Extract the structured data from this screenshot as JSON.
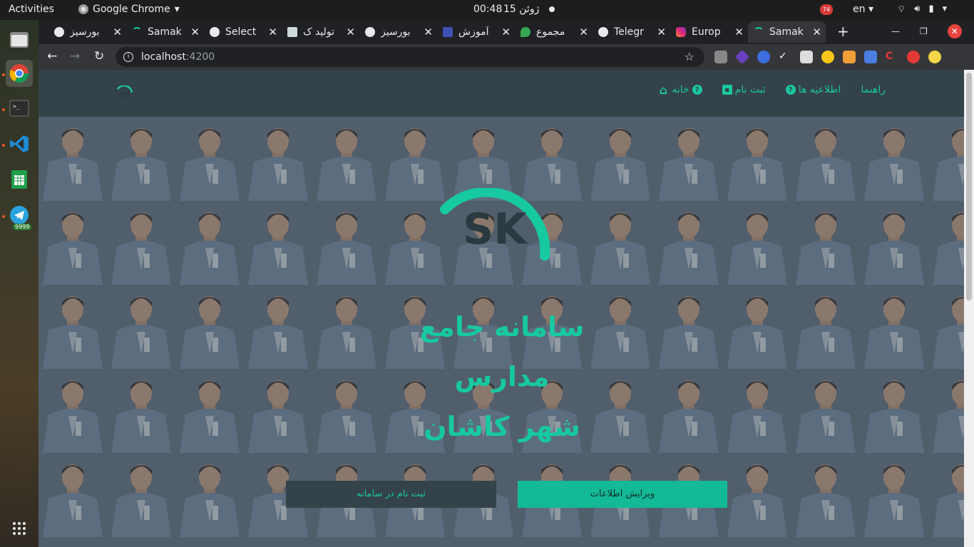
{
  "system": {
    "activities": "Activities",
    "app_name": "Google Chrome",
    "clock_time": "00:48",
    "clock_date": "ژوئن 15",
    "notification_count": "74",
    "lang": "en"
  },
  "dock": {
    "telegram_badge": "9999"
  },
  "browser": {
    "tabs": [
      {
        "title": "بورسیز"
      },
      {
        "title": "Samak"
      },
      {
        "title": "Select"
      },
      {
        "title": "تولید ک"
      },
      {
        "title": "بورسیز"
      },
      {
        "title": "آموزش"
      },
      {
        "title": "مجموع"
      },
      {
        "title": "Telegr"
      },
      {
        "title": "Europ"
      },
      {
        "title": "Samak"
      }
    ],
    "url_host": "localhost",
    "url_port": ":4200"
  },
  "site": {
    "nav": {
      "home": "خانه",
      "register": "ثبت نام",
      "announcements": "اطلاعیه ها",
      "help": "راهنما"
    },
    "hero": {
      "title_line1": "سامانه جامع",
      "title_line2": "مدارس",
      "title_line3": "شهر کاشان",
      "register_button": "ثبت نام در سامانه",
      "edit_button": "ویرایش اطلاعات"
    },
    "colors": {
      "accent": "#19c7a0",
      "navbar": "#34424a",
      "edit_button": "#14b997"
    }
  }
}
